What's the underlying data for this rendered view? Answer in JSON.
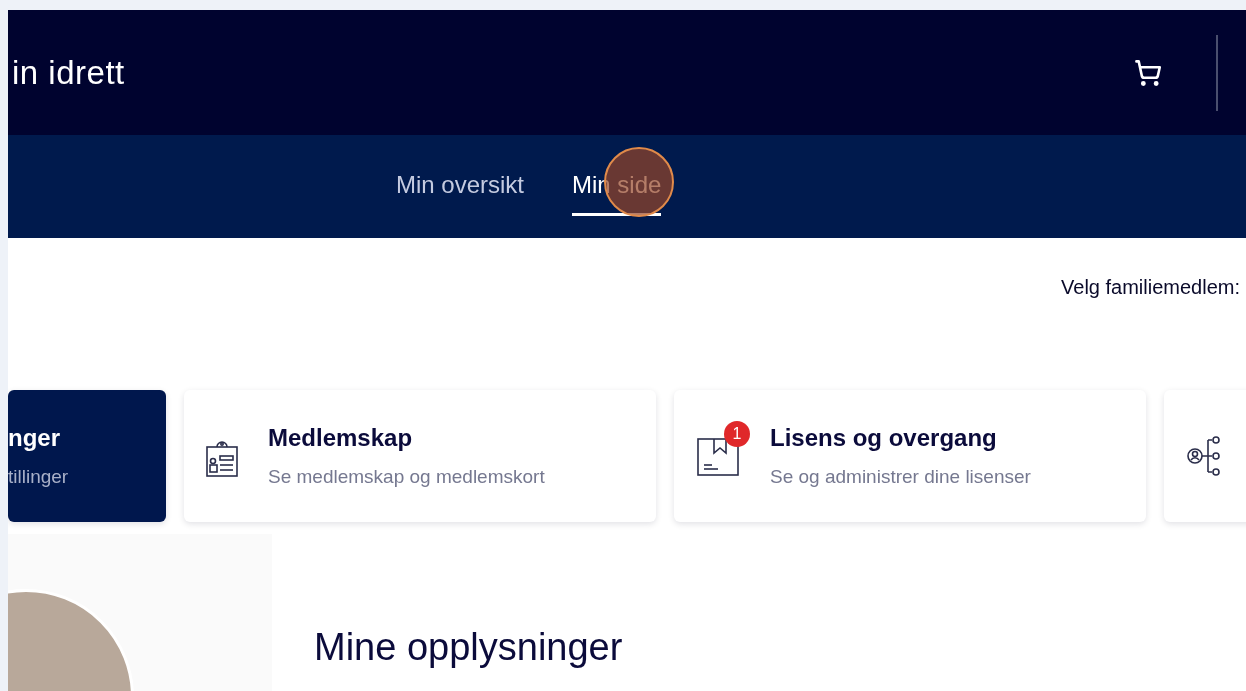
{
  "header": {
    "title": "in idrett"
  },
  "nav": {
    "tabs": [
      {
        "label": "Min oversikt",
        "selected": false
      },
      {
        "label": "Min side",
        "selected": true
      }
    ]
  },
  "family": {
    "label": "Velg familiemedlem:"
  },
  "cards": [
    {
      "kind": "settings",
      "title": "nger",
      "subtitle": "tillinger",
      "selected": true
    },
    {
      "kind": "membership",
      "title": "Medlemskap",
      "subtitle": "Se medlemskap og medlemskort",
      "selected": false
    },
    {
      "kind": "license",
      "title": "Lisens og overgang",
      "subtitle": "Se og administrer dine lisenser",
      "selected": false,
      "badge": "1"
    },
    {
      "kind": "family",
      "selected": false
    }
  ],
  "profile": {
    "heading": "Mine opplysninger"
  }
}
